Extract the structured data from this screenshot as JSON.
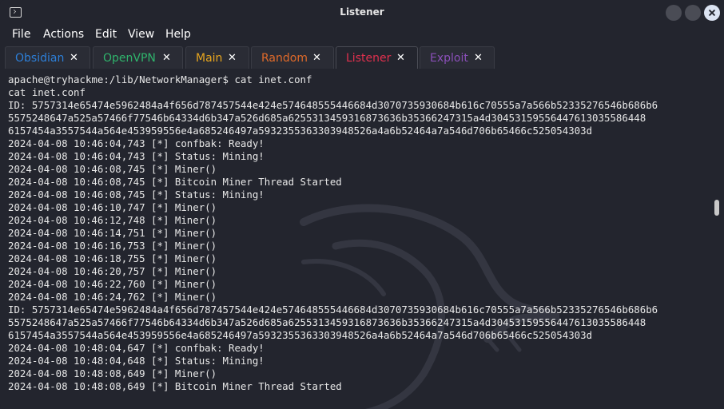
{
  "window": {
    "title": "Listener",
    "icon": "terminal-icon"
  },
  "menu": [
    "File",
    "Actions",
    "Edit",
    "View",
    "Help"
  ],
  "tabs": [
    {
      "label": "Obsidian",
      "color": "#2d7fd8",
      "active": false
    },
    {
      "label": "OpenVPN",
      "color": "#2fb46c",
      "active": false
    },
    {
      "label": "Main",
      "color": "#e7a51e",
      "active": false
    },
    {
      "label": "Random",
      "color": "#e06a2a",
      "active": false
    },
    {
      "label": "Listener",
      "color": "#e0304e",
      "active": true
    },
    {
      "label": "Exploit",
      "color": "#8a4fb8",
      "active": false
    }
  ],
  "tab_close_glyph": "✕",
  "terminal": {
    "lines": [
      "apache@tryhackme:/lib/NetworkManager$ cat inet.conf",
      "cat inet.conf",
      "ID: 5757314e65474e5962484a4f656d787457544e424e574648555446684d3070735930684b616c70555a7a566b52335276546b686b6",
      "5575248647a525a57466f77546b64334d6b347a526d685a6255313459316873636b35366247315a4d30453159556447613035586448",
      "6157454a3557544a564e453959556e4a685246497a5932355363303948526a4a6b52464a7a546d706b65466c525054303d",
      "2024-04-08 10:46:04,743 [*] confbak: Ready!",
      "2024-04-08 10:46:04,743 [*] Status: Mining!",
      "2024-04-08 10:46:08,745 [*] Miner()",
      "2024-04-08 10:46:08,745 [*] Bitcoin Miner Thread Started",
      "2024-04-08 10:46:08,745 [*] Status: Mining!",
      "2024-04-08 10:46:10,747 [*] Miner()",
      "2024-04-08 10:46:12,748 [*] Miner()",
      "2024-04-08 10:46:14,751 [*] Miner()",
      "2024-04-08 10:46:16,753 [*] Miner()",
      "2024-04-08 10:46:18,755 [*] Miner()",
      "2024-04-08 10:46:20,757 [*] Miner()",
      "2024-04-08 10:46:22,760 [*] Miner()",
      "2024-04-08 10:46:24,762 [*] Miner()",
      "ID: 5757314e65474e5962484a4f656d787457544e424e574648555446684d3070735930684b616c70555a7a566b52335276546b686b6",
      "5575248647a525a57466f77546b64334d6b347a526d685a6255313459316873636b35366247315a4d30453159556447613035586448",
      "6157454a3557544a564e453959556e4a685246497a5932355363303948526a4a6b52464a7a546d706b65466c525054303d",
      "2024-04-08 10:48:04,647 [*] confbak: Ready!",
      "2024-04-08 10:48:04,648 [*] Status: Mining!",
      "2024-04-08 10:48:08,649 [*] Miner()",
      "2024-04-08 10:48:08,649 [*] Bitcoin Miner Thread Started"
    ]
  },
  "colors": {
    "background": "#23252e",
    "text": "#e8e8e8"
  }
}
